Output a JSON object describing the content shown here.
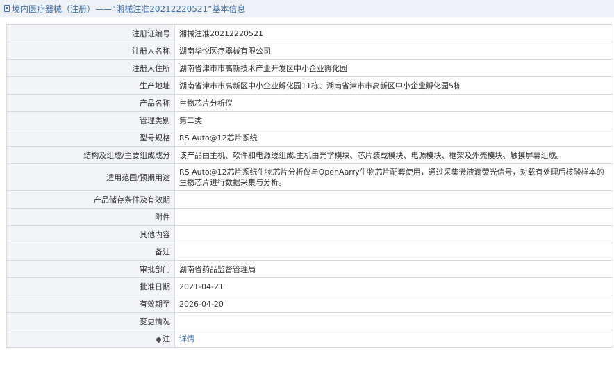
{
  "header": {
    "title": "境内医疗器械（注册）——“湘械注准20212220521”基本信息"
  },
  "rows": [
    {
      "label": "注册证编号",
      "value": "湘械注准20212220521"
    },
    {
      "label": "注册人名称",
      "value": "湖南华悦医疗器械有限公司"
    },
    {
      "label": "注册人住所",
      "value": "湖南省津市市高新技术产业开发区中小企业孵化园"
    },
    {
      "label": "生产地址",
      "value": "湖南省津市市高新区中小企业孵化园11栋、湖南省津市市高新区中小企业孵化园5栋"
    },
    {
      "label": "产品名称",
      "value": "生物芯片分析仪"
    },
    {
      "label": "管理类别",
      "value": "第二类"
    },
    {
      "label": "型号规格",
      "value": "RS Auto@12芯片系统"
    },
    {
      "label": "结构及组成/主要组成成分",
      "value": "该产品由主机、软件和电源线组成.主机由光学模块、芯片装载模块、电源模块、框架及外壳模块、触摸屏幕组成。"
    },
    {
      "label": "适用范围/预期用途",
      "value": "RS Auto@12芯片系统生物芯片分析仪与OpenAarry生物芯片配套使用，通过采集微液滴荧光信号，对载有处理后核酸样本的生物芯片进行数据采集与分析。"
    },
    {
      "label": "产品储存条件及有效期",
      "value": ""
    },
    {
      "label": "附件",
      "value": ""
    },
    {
      "label": "其他内容",
      "value": ""
    },
    {
      "label": "备注",
      "value": ""
    },
    {
      "label": "审批部门",
      "value": "湖南省药品监督管理局"
    },
    {
      "label": "批准日期",
      "value": "2021-04-21"
    },
    {
      "label": "有效期至",
      "value": "2026-04-20"
    },
    {
      "label": "变更情况",
      "value": ""
    }
  ],
  "note_row": {
    "label": "注",
    "link_text": "详情"
  }
}
